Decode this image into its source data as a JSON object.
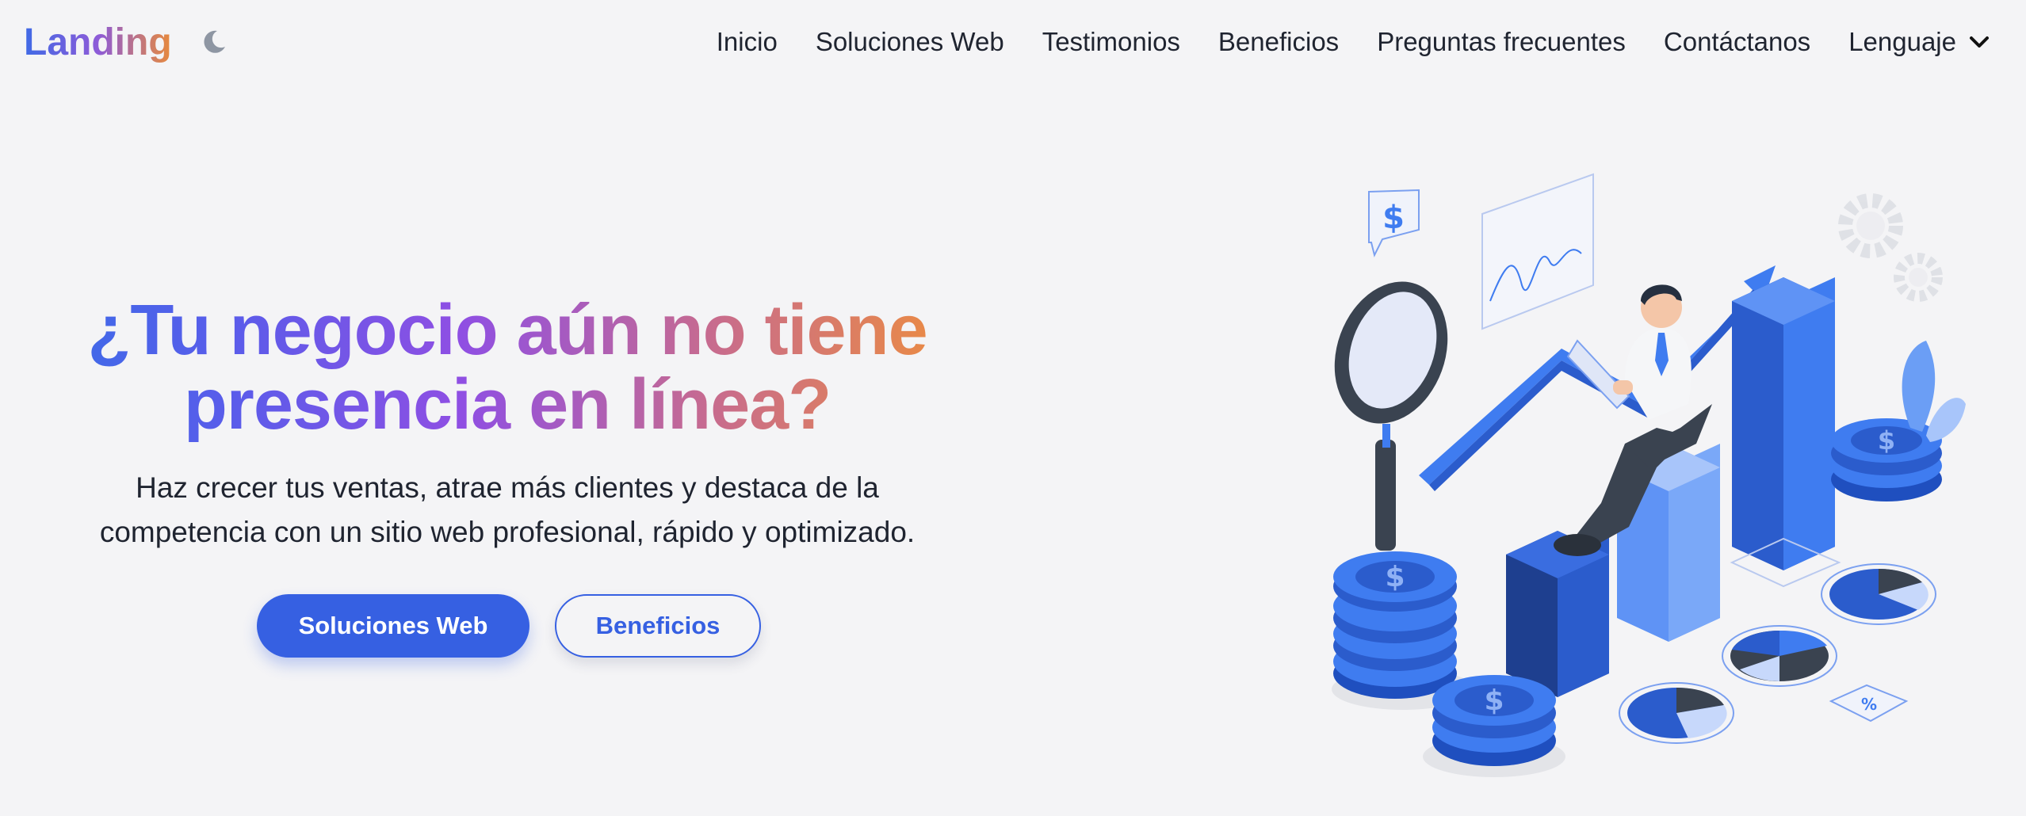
{
  "navbar": {
    "logo": "Landing",
    "theme_icon": "moon-icon",
    "links": [
      "Inicio",
      "Soluciones Web",
      "Testimonios",
      "Beneficios",
      "Preguntas frecuentes",
      "Contáctanos"
    ],
    "language_label": "Lenguaje",
    "language_icon": "chevron-down-icon"
  },
  "hero": {
    "title_line1": "¿Tu negocio aún no tiene",
    "title_line2": "presencia en línea?",
    "subtitle_line1": "Haz crecer tus ventas, atrae más clientes y destaca de la",
    "subtitle_line2": "competencia con un sitio web profesional, rápido y optimizado.",
    "primary_button": "Soluciones Web",
    "secondary_button": "Beneficios"
  },
  "colors": {
    "background": "#f4f4f6",
    "primary": "#3660e2",
    "gradient_start": "#3c6be8",
    "gradient_mid": "#8f4fe3",
    "gradient_end": "#ee8e3c",
    "illustration_blue": "#3f7cf0",
    "illustration_dark": "#3a4350"
  },
  "illustration": {
    "icons": [
      "business-growth-illustration",
      "magnifier-icon",
      "dollar-coin-icon",
      "pie-chart-icon",
      "gear-icon",
      "arrow-up-icon",
      "percent-tag-icon",
      "line-chart-icon"
    ]
  }
}
